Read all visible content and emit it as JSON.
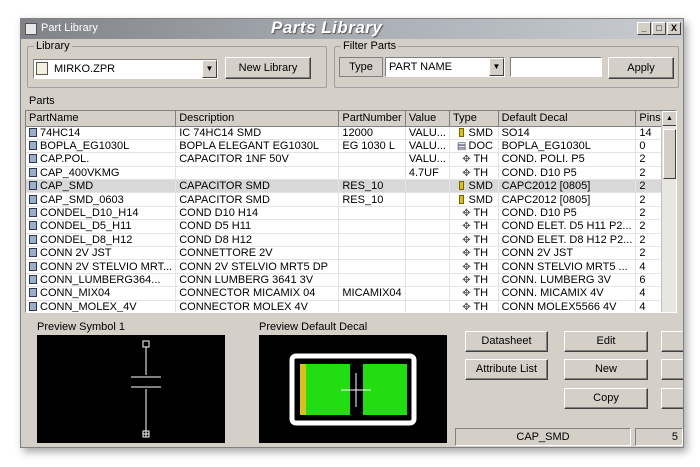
{
  "window": {
    "title_small": "Part Library",
    "title": "Parts Library",
    "buttons": [
      "_",
      "□",
      "X"
    ]
  },
  "library": {
    "legend": "Library",
    "selected": "MIRKO.ZPR",
    "new_library_label": "New Library"
  },
  "filter": {
    "legend": "Filter Parts",
    "type_label": "Type",
    "type_selected": "PART NAME",
    "value": "",
    "apply_label": "Apply"
  },
  "parts": {
    "label": "Parts",
    "columns": [
      "PartName",
      "Description",
      "PartNumber",
      "Value",
      "Type",
      "Default Decal",
      "Pins"
    ],
    "rows": [
      {
        "name": "74HC14",
        "desc": "IC 74HC14 SMD",
        "pn": "12000",
        "val": "VALU...",
        "type": "SMD",
        "decal": "SO14",
        "pins": "14",
        "type_icon": "smd-chip-icon"
      },
      {
        "name": "BOPLA_EG1030L",
        "desc": "BOPLA ELEGANT EG1030L",
        "pn": "EG 1030 L",
        "val": "VALU...",
        "type": "DOC",
        "decal": "BOPLA_EG1030L",
        "pins": "0",
        "type_icon": "doc-icon"
      },
      {
        "name": "CAP.POL.",
        "desc": "CAPACITOR 1NF 50V",
        "pn": "",
        "val": "VALU...",
        "type": "TH",
        "decal": "COND. POLI. P5",
        "pins": "2",
        "type_icon": "through-hole-icon"
      },
      {
        "name": "CAP_400VKMG",
        "desc": "",
        "pn": "",
        "val": "4.7UF",
        "type": "TH",
        "decal": "COND. D10 P5",
        "pins": "2",
        "type_icon": "through-hole-icon"
      },
      {
        "name": "CAP_SMD",
        "desc": "CAPACITOR SMD",
        "pn": "RES_10",
        "val": "",
        "type": "SMD",
        "decal": "CAPC2012 [0805]",
        "pins": "2",
        "type_icon": "smd-chip-icon"
      },
      {
        "name": "CAP_SMD_0603",
        "desc": "CAPACITOR SMD",
        "pn": "RES_10",
        "val": "",
        "type": "SMD",
        "decal": "CAPC2012 [0805]",
        "pins": "2",
        "type_icon": "smd-chip-icon"
      },
      {
        "name": "CONDEL_D10_H14",
        "desc": "COND D10 H14",
        "pn": "",
        "val": "",
        "type": "TH",
        "decal": "COND. D10 P5",
        "pins": "2",
        "type_icon": "through-hole-icon"
      },
      {
        "name": "CONDEL_D5_H11",
        "desc": "COND D5 H11",
        "pn": "",
        "val": "",
        "type": "TH",
        "decal": "COND ELET. D5 H11 P2...",
        "pins": "2",
        "type_icon": "through-hole-icon"
      },
      {
        "name": "CONDEL_D8_H12",
        "desc": "COND D8 H12",
        "pn": "",
        "val": "",
        "type": "TH",
        "decal": "COND ELET. D8 H12 P2...",
        "pins": "2",
        "type_icon": "through-hole-icon"
      },
      {
        "name": "CONN 2V JST",
        "desc": "CONNETTORE 2V",
        "pn": "",
        "val": "",
        "type": "TH",
        "decal": "CONN 2V JST",
        "pins": "2",
        "type_icon": "through-hole-icon"
      },
      {
        "name": "CONN 2V STELVIO MRT...",
        "desc": "CONN 2V STELVIO MRT5 DP",
        "pn": "",
        "val": "",
        "type": "TH",
        "decal": "CONN STELVIO MRT5 ...",
        "pins": "4",
        "type_icon": "through-hole-icon"
      },
      {
        "name": "CONN_LUMBERG364...",
        "desc": "CONN LUMBERG 3641 3V",
        "pn": "",
        "val": "",
        "type": "TH",
        "decal": "CONN. LUMBERG 3V",
        "pins": "6",
        "type_icon": "through-hole-icon"
      },
      {
        "name": "CONN_MIX04",
        "desc": "CONNECTOR MICAMIX 04",
        "pn": "MICAMIX04",
        "val": "",
        "type": "TH",
        "decal": "CONN. MICAMIX 4V",
        "pins": "4",
        "type_icon": "through-hole-icon"
      },
      {
        "name": "CONN_MOLEX_4V",
        "desc": "CONNECTOR MOLEX 4V",
        "pn": "",
        "val": "",
        "type": "TH",
        "decal": "CONN MOLEX5566 4V",
        "pins": "4",
        "type_icon": "through-hole-icon"
      }
    ],
    "selected_index": 4
  },
  "preview_symbol": {
    "label": "Preview Symbol 1"
  },
  "preview_decal": {
    "label": "Preview Default Decal"
  },
  "actions": {
    "datasheet_label": "Datasheet",
    "edit_label": "Edit",
    "attribute_list_label": "Attribute List",
    "new_label": "New",
    "copy_label": "Copy"
  },
  "status": {
    "part": "CAP_SMD",
    "right": "5"
  },
  "colors": {
    "pad": "#22dd11",
    "outline": "#ffffff",
    "preview_bg": "#000000"
  }
}
